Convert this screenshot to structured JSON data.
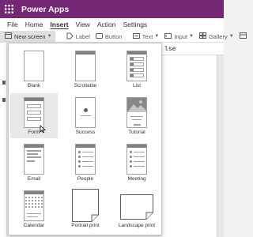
{
  "app": {
    "title": "Power Apps",
    "brand_color": "#742774"
  },
  "menubar": {
    "items": [
      "File",
      "Home",
      "Insert",
      "View",
      "Action",
      "Settings"
    ],
    "active": "Insert"
  },
  "ribbon": {
    "new_screen": "New screen",
    "label": "Label",
    "button": "Button",
    "text": "Text",
    "input": "Input",
    "gallery": "Gallery"
  },
  "formula_bar": {
    "text": "lse"
  },
  "screen_templates": [
    {
      "label": "Blank"
    },
    {
      "label": "Scrollable"
    },
    {
      "label": "List"
    },
    {
      "label": "Form",
      "hovered": true
    },
    {
      "label": "Success"
    },
    {
      "label": "Tutorial"
    },
    {
      "label": "Email"
    },
    {
      "label": "People"
    },
    {
      "label": "Meeting"
    },
    {
      "label": "Calendar"
    },
    {
      "label": "Portrait print"
    },
    {
      "label": "Landscape print"
    }
  ]
}
